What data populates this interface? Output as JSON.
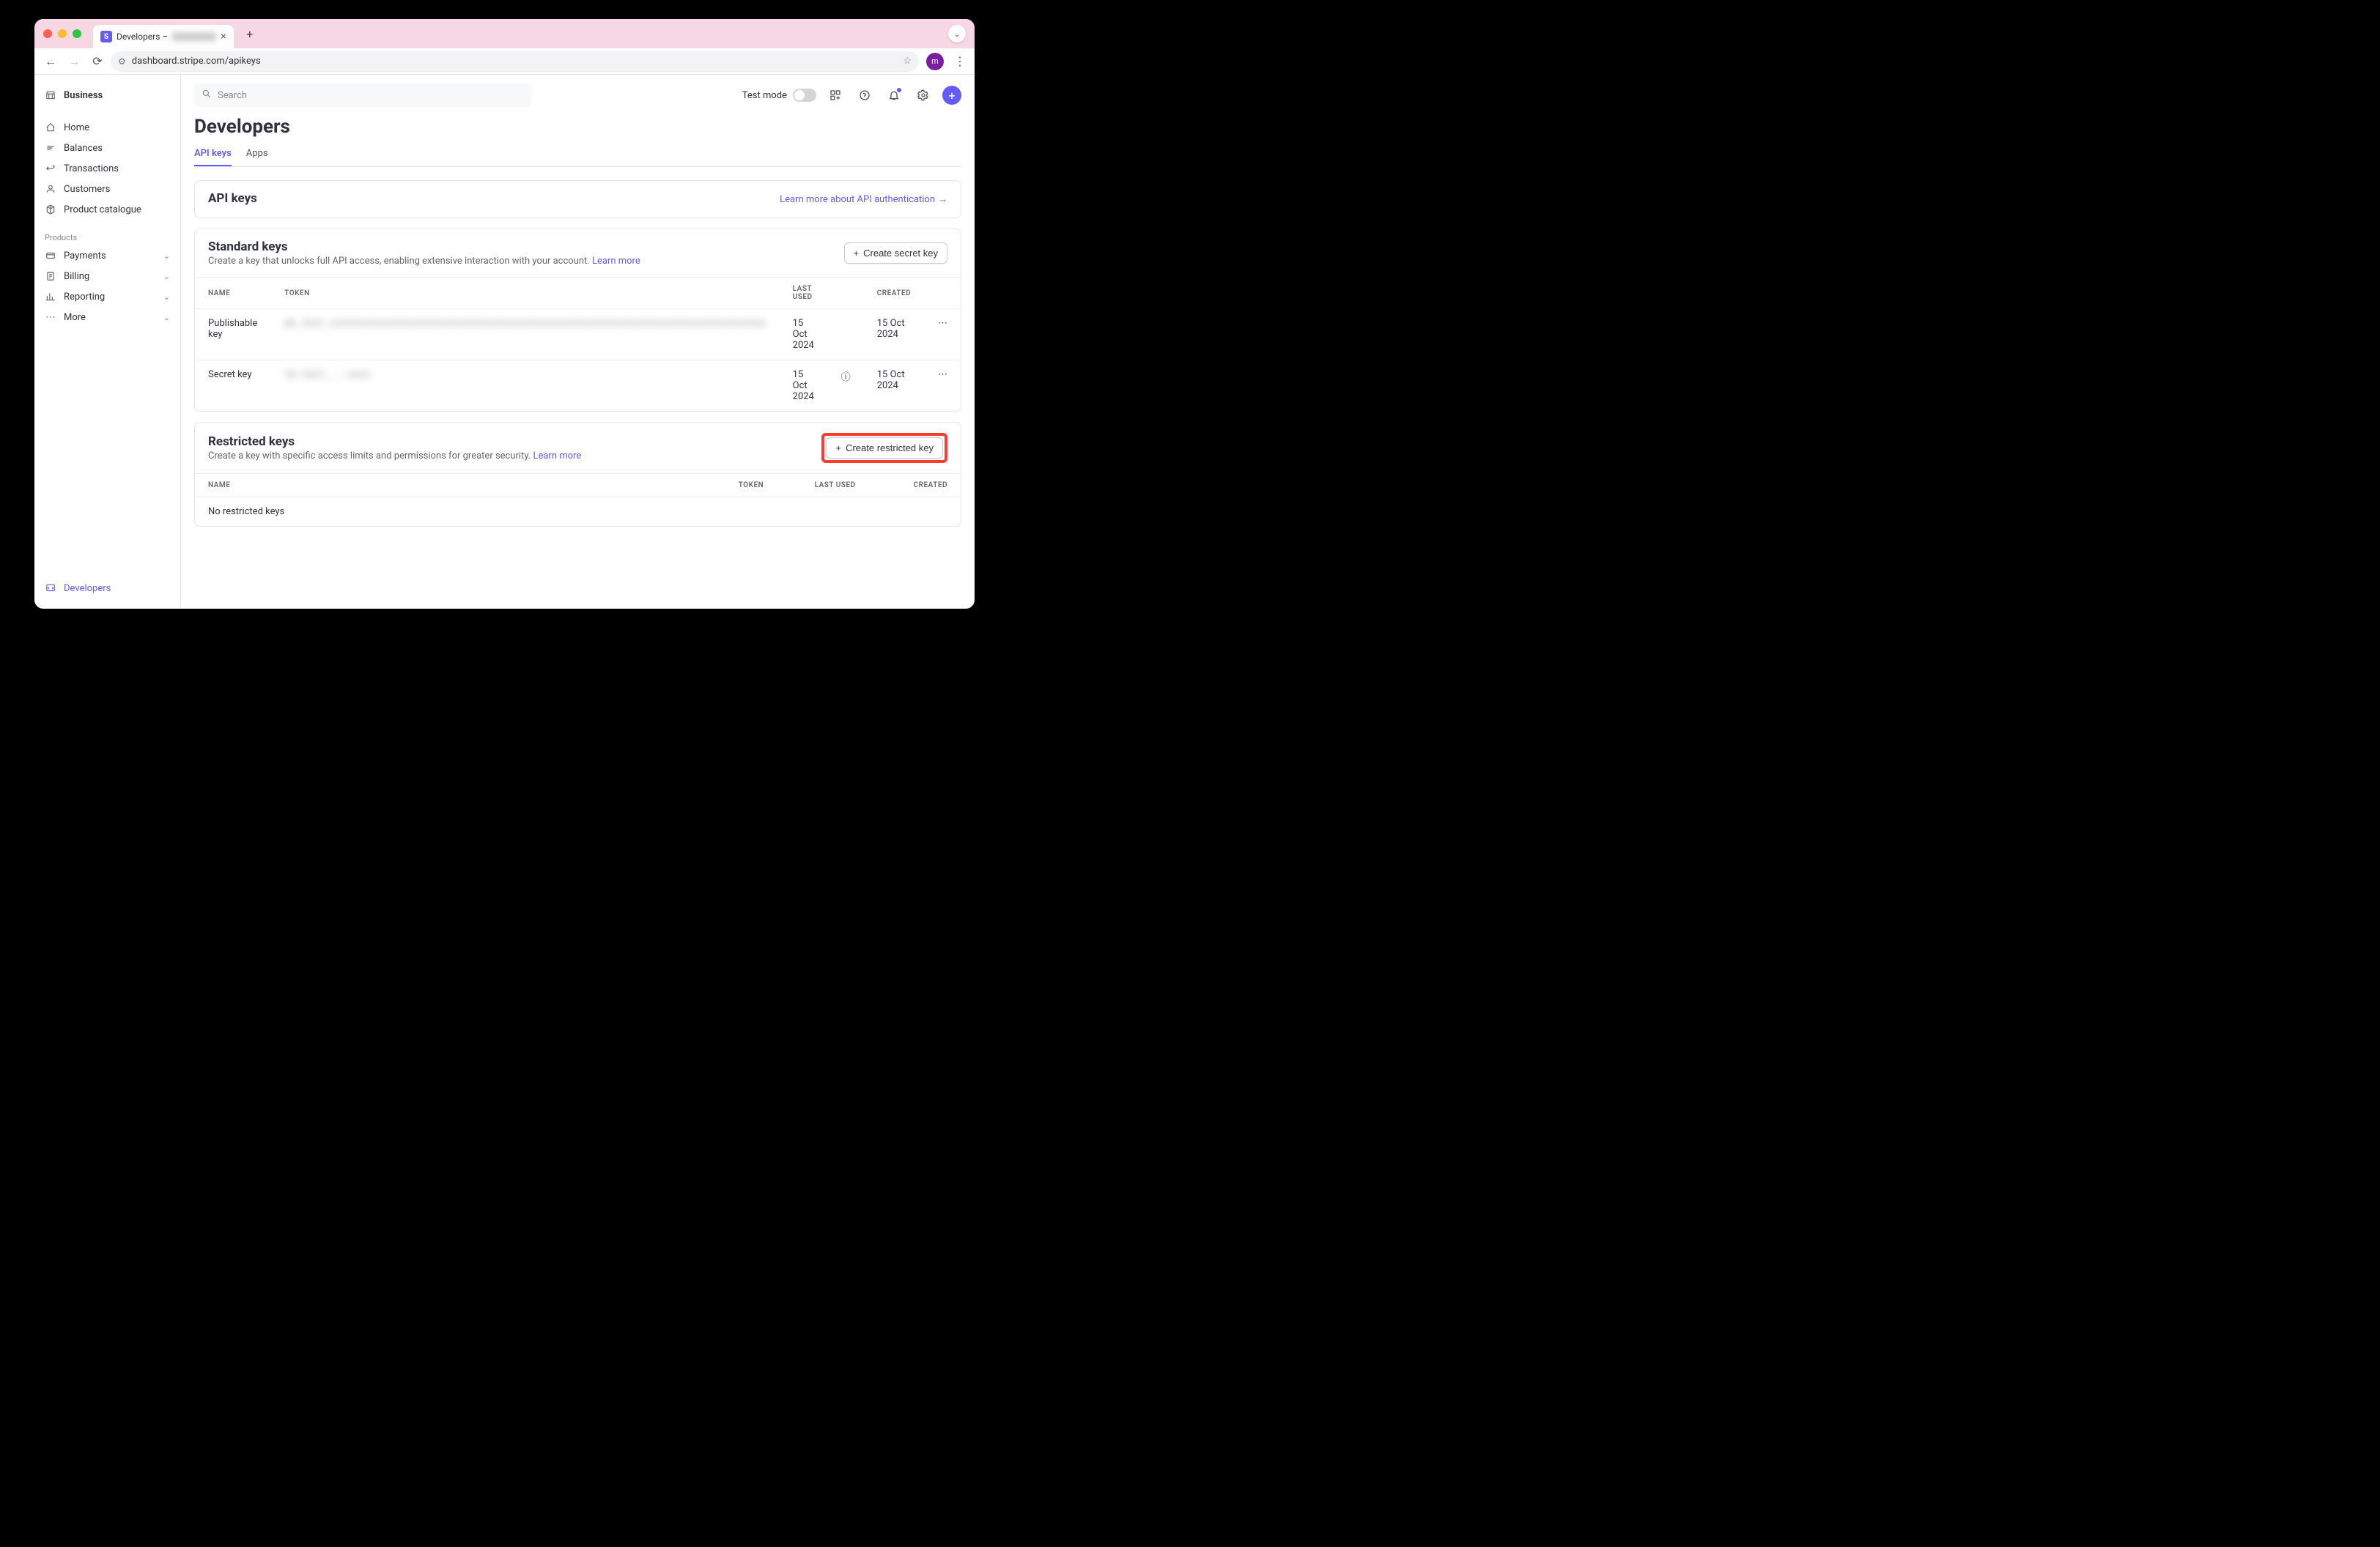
{
  "browser": {
    "tab_title": "Developers – ",
    "url": "dashboard.stripe.com/apikeys",
    "avatar_letter": "m"
  },
  "sidebar": {
    "business": "Business",
    "items": [
      {
        "label": "Home",
        "icon": "home"
      },
      {
        "label": "Balances",
        "icon": "balances"
      },
      {
        "label": "Transactions",
        "icon": "transactions"
      },
      {
        "label": "Customers",
        "icon": "customers"
      },
      {
        "label": "Product catalogue",
        "icon": "catalog"
      }
    ],
    "products_label": "Products",
    "products": [
      {
        "label": "Payments"
      },
      {
        "label": "Billing"
      },
      {
        "label": "Reporting"
      },
      {
        "label": "More"
      }
    ],
    "developers": "Developers"
  },
  "topbar": {
    "search_placeholder": "Search",
    "test_mode_label": "Test mode"
  },
  "page": {
    "title": "Developers",
    "tabs": {
      "api_keys": "API keys",
      "apps": "Apps"
    },
    "api_keys_card": {
      "title": "API keys",
      "learn_more": "Learn more about API authentication"
    },
    "standard": {
      "title": "Standard keys",
      "subtitle": "Create a key that unlocks full API access, enabling extensive interaction with your account. ",
      "learn_more": "Learn more",
      "button": "Create secret key",
      "columns": {
        "name": "NAME",
        "token": "TOKEN",
        "last_used": "LAST USED",
        "created": "CREATED"
      },
      "rows": [
        {
          "name": "Publishable key",
          "token": "pk_test_xxxxxxxxxxxxxxxxxxxxxxxxxxxxxxxxxxxxxxxxxxxxxxxxxxxxxxxxxxxxxxxxxxxxxxxxxxxx",
          "last_used": "15 Oct 2024",
          "created": "15 Oct 2024"
        },
        {
          "name": "Secret key",
          "token": "sk_test_...xxxx",
          "last_used": "15 Oct 2024",
          "created": "15 Oct 2024"
        }
      ]
    },
    "restricted": {
      "title": "Restricted keys",
      "subtitle": "Create a key with specific access limits and permissions for greater security. ",
      "learn_more": "Learn more",
      "button": "Create restricted key",
      "columns": {
        "name": "NAME",
        "token": "TOKEN",
        "last_used": "LAST USED",
        "created": "CREATED"
      },
      "empty": "No restricted keys"
    }
  }
}
